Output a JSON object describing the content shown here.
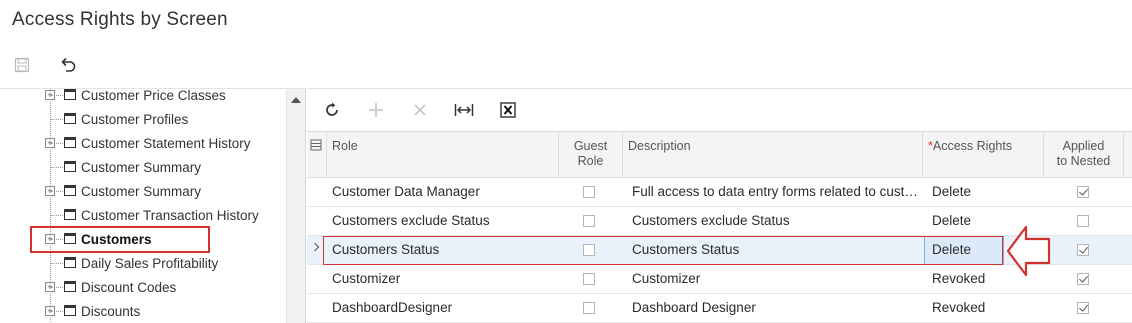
{
  "page": {
    "title": "Access Rights by Screen"
  },
  "toolbar": {
    "save_icon": "save-icon",
    "undo_icon": "undo-icon"
  },
  "tree": {
    "items": [
      {
        "label": "Customer Price Classes",
        "expandable": true,
        "bold": false
      },
      {
        "label": "Customer Profiles",
        "expandable": false,
        "bold": false
      },
      {
        "label": "Customer Statement History",
        "expandable": true,
        "bold": false
      },
      {
        "label": "Customer Summary",
        "expandable": false,
        "bold": false
      },
      {
        "label": "Customer Summary",
        "expandable": true,
        "bold": false
      },
      {
        "label": "Customer Transaction History",
        "expandable": false,
        "bold": false
      },
      {
        "label": "Customers",
        "expandable": true,
        "bold": true,
        "selected": true
      },
      {
        "label": "Daily Sales Profitability",
        "expandable": false,
        "bold": false
      },
      {
        "label": "Discount Codes",
        "expandable": true,
        "bold": false
      },
      {
        "label": "Discounts",
        "expandable": true,
        "bold": false
      }
    ]
  },
  "grid": {
    "toolbar": [
      "refresh-icon",
      "add-icon",
      "delete-icon",
      "fit-columns-icon",
      "export-excel-icon"
    ],
    "columns": {
      "role": "Role",
      "guest_role": [
        "Guest",
        "Role"
      ],
      "description": "Description",
      "access_rights_required": "*",
      "access_rights": "Access Rights",
      "applied_to_nested": [
        "Applied",
        "to Nested"
      ]
    },
    "rows": [
      {
        "role": "Customer Data Manager",
        "guest": false,
        "description": "Full access to data entry forms related to custo...",
        "rights": "Delete",
        "nested": true,
        "active": false
      },
      {
        "role": "Customers exclude Status",
        "guest": false,
        "description": "Customers exclude Status",
        "rights": "Delete",
        "nested": false,
        "active": false
      },
      {
        "role": "Customers Status",
        "guest": false,
        "description": "Customers Status",
        "rights": "Delete",
        "nested": true,
        "active": true
      },
      {
        "role": "Customizer",
        "guest": false,
        "description": "Customizer",
        "rights": "Revoked",
        "nested": true,
        "active": false
      },
      {
        "role": "DashboardDesigner",
        "guest": false,
        "description": "Dashboard Designer",
        "rights": "Revoked",
        "nested": true,
        "active": false
      }
    ]
  },
  "colors": {
    "highlight": "#d1312f",
    "active_row": "#e9f2fb"
  }
}
